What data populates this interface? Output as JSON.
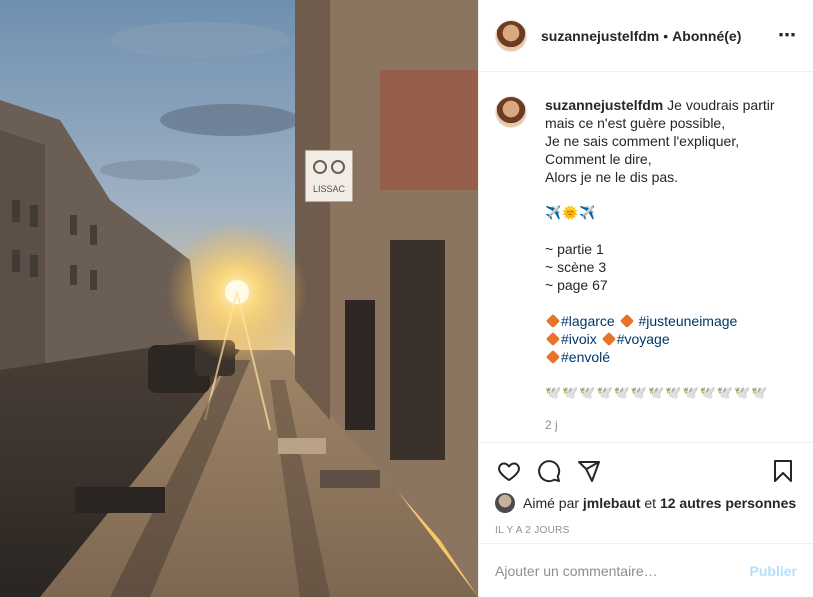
{
  "post": {
    "username": "suzannejustelfdm",
    "dot": "•",
    "follow_status": "Abonné(e)",
    "more_icon": "⋯"
  },
  "caption": {
    "username": "suzannejustelfdm",
    "lines": [
      "Je voudrais partir",
      "mais ce n'est guère possible,",
      "Je ne sais comment l'expliquer,",
      "Comment le dire,",
      "Alors je ne le dis pas."
    ],
    "emoji_line": "✈️🌞✈️",
    "episode": [
      "~ partie 1",
      "~ scène 3",
      "~ page 67"
    ],
    "hashtags": [
      "#lagarce",
      "#justeuneimage",
      "#ivoix",
      "#voyage",
      "#envolé"
    ],
    "bird_line": "🕊️🕊️🕊️🕊️🕊️🕊️🕊️🕊️🕊️🕊️🕊️🕊️🕊️",
    "time_ago": "2 j"
  },
  "likes": {
    "prefix": "Aimé par",
    "user": "jmlebaut",
    "connector": "et",
    "others": "12 autres personnes"
  },
  "date": "IL Y A 2 JOURS",
  "comment_box": {
    "placeholder": "Ajouter un commentaire…",
    "publish_label": "Publier"
  },
  "photo": {
    "storefront_sign": "LISSAC"
  },
  "colors": {
    "link": "#00376b",
    "muted": "#8e8e8e",
    "publish_disabled": "#b2dffc",
    "diamond": "#e8732b"
  }
}
